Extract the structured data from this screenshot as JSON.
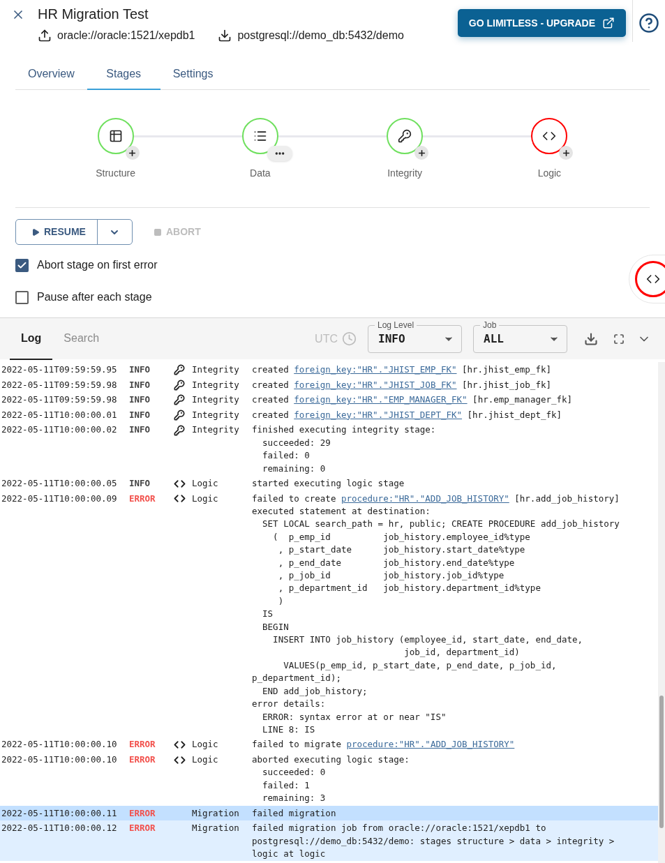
{
  "header": {
    "title": "HR Migration Test",
    "source": "oracle://oracle:1521/xepdb1",
    "target": "postgresql://demo_db:5432/demo",
    "upgrade_button": "GO LIMITLESS - UPGRADE"
  },
  "tabs": [
    {
      "label": "Overview",
      "selected": false
    },
    {
      "label": "Stages",
      "selected": true
    },
    {
      "label": "Settings",
      "selected": false
    }
  ],
  "stages": [
    {
      "label": "Structure",
      "kind": "structure",
      "failed": false,
      "menu_open": false
    },
    {
      "label": "Data",
      "kind": "data",
      "failed": false,
      "menu_open": true
    },
    {
      "label": "Integrity",
      "kind": "integrity",
      "failed": false,
      "menu_open": false
    },
    {
      "label": "Logic",
      "kind": "logic",
      "failed": true,
      "menu_open": false
    }
  ],
  "controls": {
    "resume": "RESUME",
    "abort": {
      "label": "ABORT",
      "disabled": true
    }
  },
  "options": [
    {
      "label": "Abort stage on first error",
      "checked": true
    },
    {
      "label": "Pause after each stage",
      "checked": false
    }
  ],
  "log_panel": {
    "tabs": [
      {
        "label": "Log",
        "selected": true
      },
      {
        "label": "Search",
        "selected": false
      }
    ],
    "utc": {
      "label": "UTC"
    },
    "filters": [
      {
        "label": "Log Level",
        "value": "INFO"
      },
      {
        "label": "Job",
        "value": "ALL"
      }
    ],
    "entries": [
      {
        "time": "2022-05-11T09:59:59.95",
        "level": "INFO",
        "kind": "integrity",
        "stage": "Integrity",
        "message": [
          {
            "text": "created "
          },
          {
            "link": "foreign_key:\"HR\".\"JHIST_EMP_FK\""
          },
          {
            "text": " [hr.jhist_emp_fk]"
          }
        ],
        "selected": false,
        "hovered": false
      },
      {
        "time": "2022-05-11T09:59:59.98",
        "level": "INFO",
        "kind": "integrity",
        "stage": "Integrity",
        "message": [
          {
            "text": "created "
          },
          {
            "link": "foreign_key:\"HR\".\"JHIST_JOB_FK\""
          },
          {
            "text": " [hr.jhist_job_fk]"
          }
        ],
        "selected": false,
        "hovered": false
      },
      {
        "time": "2022-05-11T09:59:59.98",
        "level": "INFO",
        "kind": "integrity",
        "stage": "Integrity",
        "message": [
          {
            "text": "created "
          },
          {
            "link": "foreign_key:\"HR\".\"EMP_MANAGER_FK\""
          },
          {
            "text": " [hr.emp_manager_fk]"
          }
        ],
        "selected": false,
        "hovered": false
      },
      {
        "time": "2022-05-11T10:00:00.01",
        "level": "INFO",
        "kind": "integrity",
        "stage": "Integrity",
        "message": [
          {
            "text": "created "
          },
          {
            "link": "foreign_key:\"HR\".\"JHIST_DEPT_FK\""
          },
          {
            "text": " [hr.jhist_dept_fk]"
          }
        ],
        "selected": false,
        "hovered": false
      },
      {
        "time": "2022-05-11T10:00:00.02",
        "level": "INFO",
        "kind": "integrity",
        "stage": "Integrity",
        "message": [
          {
            "text": "finished executing integrity stage:"
          }
        ],
        "details": "  succeeded: 29\n  failed: 0\n  remaining: 0",
        "selected": false,
        "hovered": false
      },
      {
        "time": "2022-05-11T10:00:00.05",
        "level": "INFO",
        "kind": "logic",
        "stage": "Logic",
        "message": [
          {
            "text": "started executing logic stage"
          }
        ],
        "selected": false,
        "hovered": false
      },
      {
        "time": "2022-05-11T10:00:00.09",
        "level": "ERROR",
        "kind": "logic",
        "stage": "Logic",
        "message": [
          {
            "text": "failed to create "
          },
          {
            "link": "procedure:\"HR\".\"ADD_JOB_HISTORY\""
          },
          {
            "text": " [hr.add_job_history]"
          }
        ],
        "details": "executed statement at destination:\n  SET LOCAL search_path = hr, public; CREATE PROCEDURE add_job_history\n    (  p_emp_id          job_history.employee_id%type\n     , p_start_date      job_history.start_date%type\n     , p_end_date        job_history.end_date%type\n     , p_job_id          job_history.job_id%type\n     , p_department_id   job_history.department_id%type\n     )\n  IS\n  BEGIN\n    INSERT INTO job_history (employee_id, start_date, end_date,\n                             job_id, department_id)\n      VALUES(p_emp_id, p_start_date, p_end_date, p_job_id,\np_department_id);\n  END add_job_history;\nerror details:\n  ERROR: syntax error at or near \"IS\"\n  LINE 8: IS",
        "selected": false,
        "hovered": false
      },
      {
        "time": "2022-05-11T10:00:00.10",
        "level": "ERROR",
        "kind": "logic",
        "stage": "Logic",
        "message": [
          {
            "text": "failed to migrate "
          },
          {
            "link": "procedure:\"HR\".\"ADD_JOB_HISTORY\""
          }
        ],
        "selected": false,
        "hovered": false
      },
      {
        "time": "2022-05-11T10:00:00.10",
        "level": "ERROR",
        "kind": "logic",
        "stage": "Logic",
        "message": [
          {
            "text": "aborted executing logic stage:"
          }
        ],
        "details": "  succeeded: 0\n  failed: 1\n  remaining: 3",
        "selected": false,
        "hovered": false
      },
      {
        "time": "2022-05-11T10:00:00.11",
        "level": "ERROR",
        "kind": "migration",
        "stage": "Migration",
        "message": [
          {
            "text": "failed migration"
          }
        ],
        "selected": true,
        "hovered": false
      },
      {
        "time": "2022-05-11T10:00:00.12",
        "level": "ERROR",
        "kind": "migration",
        "stage": "Migration",
        "message": [
          {
            "text": "failed migration job from oracle://oracle:1521/xepdb1 to postgresql://demo_db:5432/demo: stages structure > data > integrity > logic at logic"
          }
        ],
        "selected": false,
        "hovered": true
      }
    ]
  }
}
